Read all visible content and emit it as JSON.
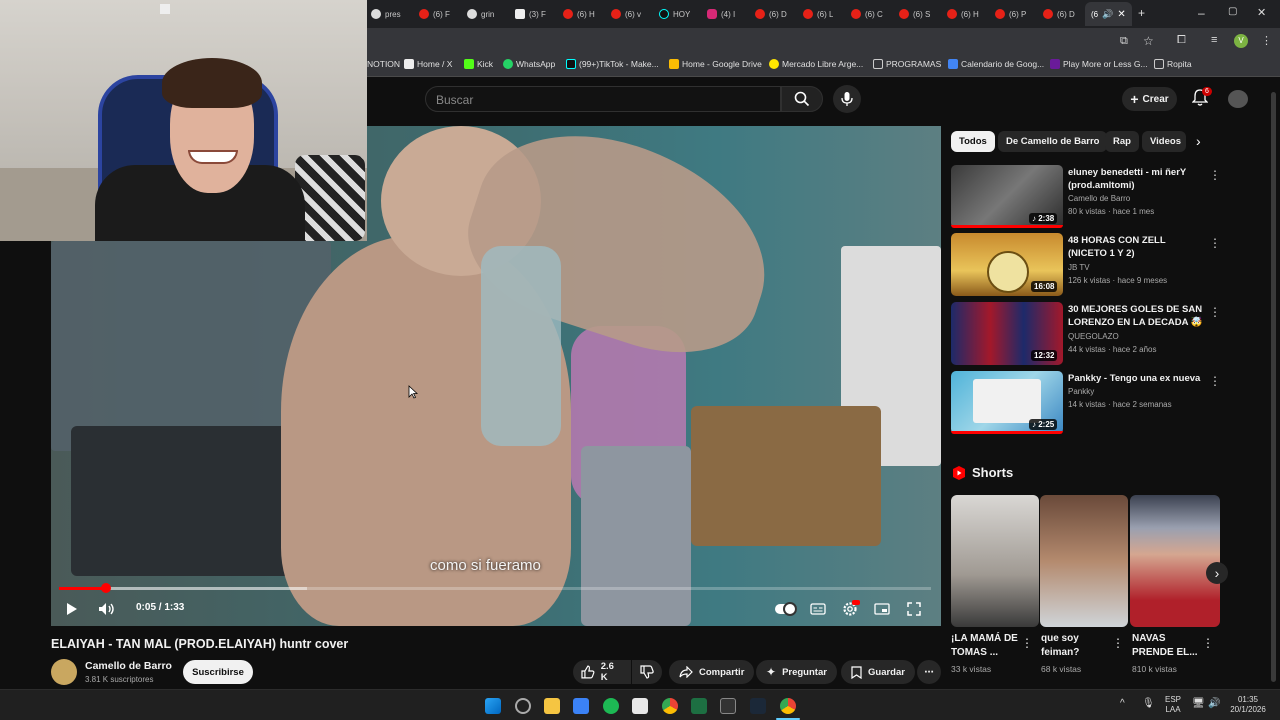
{
  "browser": {
    "tabs": [
      "pres",
      "(6) F",
      "grin",
      "(3) F",
      "(6) H",
      "(6) v",
      "HOY",
      "(4) I",
      "(6) D",
      "(6) L",
      "(6) C",
      "(6) S",
      "(6) H",
      "(6) P",
      "(6) D",
      "(6"
    ],
    "bookmarks": [
      "NOTION",
      "Home / X",
      "Kick",
      "WhatsApp",
      "(99+)TikTok - Make...",
      "Home - Google Drive",
      "Mercado Libre Arge...",
      "PROGRAMAS",
      "Calendario de Goog...",
      "Play More or Less G...",
      "Ropita"
    ],
    "profile_letter": "V"
  },
  "header": {
    "search_placeholder": "Buscar",
    "create_label": "Crear",
    "notifications_count": "6"
  },
  "player": {
    "caption": "como si fueramo",
    "time": "0:05 / 1:33",
    "progress_fraction": 0.054
  },
  "video": {
    "title": "ELAIYAH - TAN MAL (PROD.ELAIYAH) huntr cover",
    "channel": "Camello de Barro",
    "subscribers": "3.81 K suscriptores",
    "subscribe_label": "Suscribirse",
    "likes": "2.6 K",
    "share_label": "Compartir",
    "ask_label": "Preguntar",
    "save_label": "Guardar"
  },
  "sidebar": {
    "chips": [
      "Todos",
      "De Camello de Barro",
      "Rap",
      "Videos"
    ],
    "recommendations": [
      {
        "title": "eluney benedetti - mi ñerY (prod.amltomi)",
        "channel": "Camello de Barro",
        "meta": "80 k vistas · hace 1 mes",
        "duration": "2:38"
      },
      {
        "title": "48 HORAS CON ZELL (NICETO 1 Y 2)",
        "channel": "JB TV",
        "meta": "126 k vistas · hace 9 meses",
        "duration": "16:08"
      },
      {
        "title": "30 MEJORES GOLES DE SAN LORENZO EN LA DECADA 🤯",
        "channel": "QUEGOLAZO",
        "meta": "44 k vistas · hace 2 años",
        "duration": "12:32"
      },
      {
        "title": "Pankky - Tengo una ex nueva",
        "channel": "Pankky",
        "meta": "14 k vistas · hace 2 semanas",
        "duration": "2:25"
      }
    ],
    "shorts_heading": "Shorts",
    "shorts": [
      {
        "title": "¡LA MAMÁ DE TOMAS ...",
        "views": "33 k vistas"
      },
      {
        "title": "que soy feiman?",
        "views": "68 k vistas"
      },
      {
        "title": "NAVAS PRENDE EL...",
        "views": "810 k vistas"
      }
    ]
  },
  "taskbar": {
    "lang": "ESP",
    "lang_sub": "LAA",
    "time": "01:35",
    "date": "20/1/2026"
  },
  "colors": {
    "accent": "#ff0000",
    "background": "#0f0f0f",
    "chip": "#272727"
  }
}
